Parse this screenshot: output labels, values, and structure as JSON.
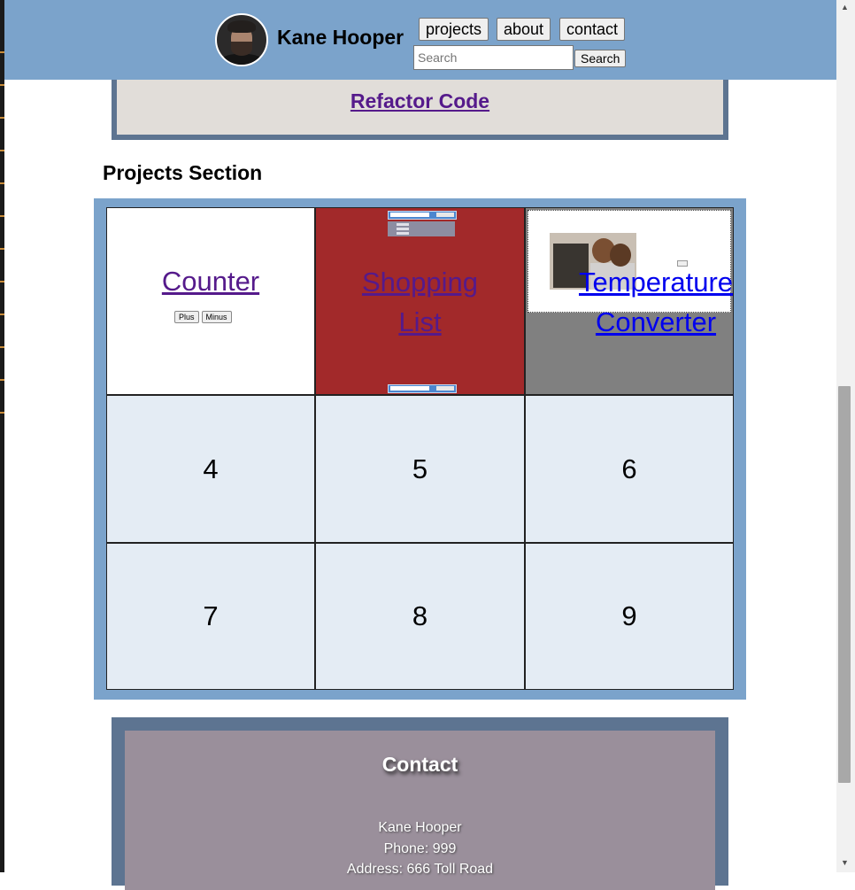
{
  "header": {
    "name": "Kane Hooper",
    "nav": [
      "projects",
      "about",
      "contact"
    ],
    "search_placeholder": "Search",
    "search_button": "Search"
  },
  "refactor": {
    "link": "Refactor Code"
  },
  "projects": {
    "title": "Projects Section",
    "counter": {
      "label": "Counter",
      "plus": "Plus",
      "minus": "Minus"
    },
    "shopping": {
      "label": "Shopping List"
    },
    "temperature": {
      "label": "Temperature Converter"
    },
    "cells": [
      "4",
      "5",
      "6",
      "7",
      "8",
      "9"
    ]
  },
  "contact": {
    "title": "Contact",
    "name": "Kane Hooper",
    "phone": "Phone: 999",
    "address": "Address: 666 Toll Road"
  }
}
